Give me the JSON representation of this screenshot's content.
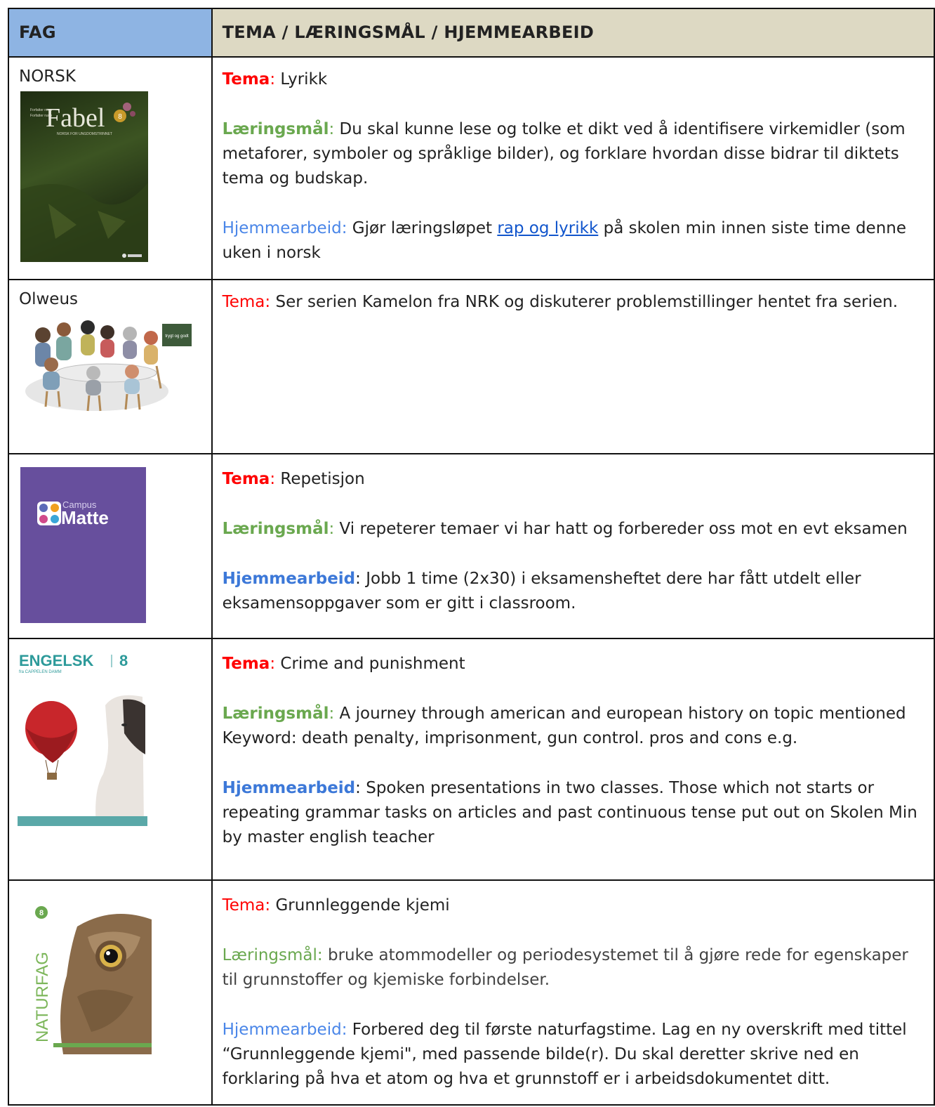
{
  "header": {
    "col_fag": "FAG",
    "col_tema": "TEMA / LÆRINGSMÅL / HJEMMEARBEID"
  },
  "rows": [
    {
      "subject": "NORSK",
      "cover_title": "Fabel",
      "cover_grade": "8",
      "cover_subtitle": "NORSK FOR UNGDOMSTRINNET",
      "tema_label": "Tema",
      "tema_sep": ":",
      "tema_text": " Lyrikk",
      "maal_label": "Læringsmål",
      "maal_sep": ":",
      "maal_text": " Du skal kunne lese og tolke et dikt ved å identifisere virkemidler (som metaforer, symboler og språklige bilder), og forklare hvordan disse bidrar til diktets tema og budskap.",
      "hjem_label": "Hjemmearbeid:",
      "hjem_pre": " Gjør læringsløpet ",
      "hjem_link": "rap og lyrikk",
      "hjem_post": " på skolen min innen siste time denne uken i norsk"
    },
    {
      "subject": "Olweus",
      "board_text": "trygt og godt",
      "tema_label": "Tema:",
      "tema_text": " Ser serien Kamelon fra NRK og diskuterer problemstillinger hentet fra serien."
    },
    {
      "cover_brand": "Campus",
      "cover_title": "Matte",
      "tema_label": "Tema",
      "tema_sep": ":",
      "tema_text": " Repetisjon",
      "maal_label": "Læringsmål",
      "maal_sep": ":",
      "maal_text": " Vi repeterer temaer vi har hatt og forbereder oss mot en evt eksamen",
      "hjem_label": "Hjemmearbeid",
      "hjem_sep": ":",
      "hjem_text": " Jobb 1 time (2x30) i eksamensheftet dere har fått utdelt eller eksamensoppgaver som er gitt i classroom."
    },
    {
      "cover_title": "ENGELSK",
      "cover_grade": "8",
      "cover_publisher": "fra CAPPELEN DAMM",
      "tema_label": "Tema",
      "tema_sep": ":",
      "tema_text": " Crime and punishment",
      "maal_label": "Læringsmål",
      "maal_sep": ":",
      "maal_text": " A journey through american and european history on topic mentioned Keyword: death penalty, imprisonment, gun control. pros and cons e.g.",
      "hjem_label": "Hjemmearbeid",
      "hjem_sep": ":",
      "hjem_text": " Spoken presentations in two classes. Those which not starts or repeating grammar tasks on articles and past continuous tense put out on Skolen Min by master english teacher"
    },
    {
      "cover_title": "NATURFAG",
      "cover_grade": "8",
      "tema_label": "Tema:",
      "tema_text": " Grunnleggende kjemi",
      "maal_label": "Læringsmål:",
      "maal_text": " bruke atommodeller og periodesystemet til å gjøre rede for egenskaper til grunnstoffer og kjemiske forbindelser.",
      "hjem_label": "Hjemmearbeid:",
      "hjem_text": " Forbered deg til første naturfagstime. Lag en ny overskrift med tittel “Grunnleggende kjemi\", med passende bilde(r). Du skal deretter skrive ned en forklaring på hva et atom og hva et grunnstoff  er i arbeidsdokumentet ditt."
    }
  ],
  "colors": {
    "header_fag_bg": "#8eb4e3",
    "header_tema_bg": "#ddd9c3",
    "tema": "#ff0000",
    "maal": "#6aa84f",
    "hjem": "#3c78d8",
    "link": "#1155cc"
  }
}
